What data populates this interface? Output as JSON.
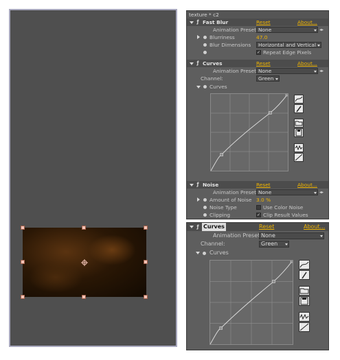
{
  "panel_top": {
    "title": "texture * c2",
    "fast_blur": {
      "name": "Fast Blur",
      "reset": "Reset",
      "about": "About...",
      "animation_presets_label": "Animation Presets:",
      "animation_presets_value": "None",
      "blurriness_label": "Blurriness",
      "blurriness_value": "47.0",
      "blur_dimensions_label": "Blur Dimensions",
      "blur_dimensions_value": "Horizontal and Vertical",
      "repeat_edge_pixels_label": "Repeat Edge Pixels",
      "repeat_edge_pixels_checked": true
    },
    "curves": {
      "name": "Curves",
      "reset": "Reset",
      "about": "About...",
      "animation_presets_label": "Animation Presets:",
      "animation_presets_value": "None",
      "channel_label": "Channel:",
      "channel_value": "Green",
      "curves_label": "Curves"
    },
    "noise": {
      "name": "Noise",
      "reset": "Reset",
      "about": "About...",
      "animation_presets_label": "Animation Presets:",
      "animation_presets_value": "None",
      "amount_label": "Amount of Noise",
      "amount_value": "3.0 %",
      "noise_type_label": "Noise Type",
      "use_color_noise_label": "Use Color Noise",
      "use_color_noise_checked": false,
      "clipping_label": "Clipping",
      "clip_result_label": "Clip Result Values",
      "clip_result_checked": true
    }
  },
  "panel_bottom": {
    "curves": {
      "name": "Curves",
      "reset": "Reset",
      "about": "About...",
      "animation_presets_label": "Animation Presets:",
      "animation_presets_value": "None",
      "channel_label": "Channel:",
      "channel_value": "Green",
      "curves_label": "Curves"
    }
  },
  "curve_points": [
    [
      0,
      0
    ],
    [
      0.1,
      0.2
    ],
    [
      0.3,
      0.42
    ],
    [
      0.7,
      0.72
    ],
    [
      1,
      1
    ]
  ],
  "icons": [
    "fx-icon",
    "curve-tool-icon",
    "pencil-tool-icon",
    "open-folder-icon",
    "save-disk-icon",
    "smooth-icon",
    "reset-line-icon",
    "stopwatch-icon"
  ]
}
